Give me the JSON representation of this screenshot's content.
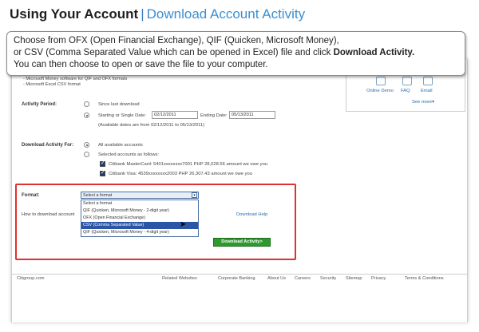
{
  "header": {
    "title_bold": "Using Your Account",
    "separator": "|",
    "title_sub": "Download Account Activity"
  },
  "callout": {
    "line1": "Choose from OFX (Open Financial Exchange), QIF (Quicken, Microsoft Money),",
    "line2_a": "or CSV (Comma Separated Value which can be opened in Excel) file and click ",
    "line2_b": "Download Activity.",
    "line3": "You can then choose to open or save the file to your computer."
  },
  "page": {
    "note1": "- Microsoft Money software for QIF and OFX formats",
    "note2": "- Microsoft Excel CSV format",
    "sidebar": {
      "online_demo": "Online Demo",
      "faq": "FAQ",
      "email": "Email",
      "see_more": "See more▾"
    },
    "activity_period": {
      "label": "Activity Period:",
      "opt1": "Since last download",
      "opt2": "Starting or Single Date:",
      "start_date": "02/12/2011",
      "ending_label": "Ending Date:",
      "end_date": "05/13/2011",
      "available": "(Available dates are from 02/12/2011 to 05/13/2011)"
    },
    "download_for": {
      "label": "Download Activity For:",
      "opt1": "All available accounts",
      "opt2": "Selected accounts as follows:",
      "acct1": "Citibank MasterCard: 5401xxxxxxxx7001 PHP 28,028.56 amount we owe you",
      "acct2": "Citibank Visa: 4539xxxxxxxx2003 PHP 26,307.43 amount we owe you"
    },
    "format": {
      "label": "Format:",
      "selected": "Select a format",
      "options": [
        "Select a format",
        "QIF (Quicken, Microsoft Money - 2-digit year)",
        "OFX (Open Financial Exchange)",
        "CSV (Comma Separated Value)",
        "QIF (Quicken, Microsoft Money - 4-digit year)"
      ],
      "how_to": "How to download account",
      "download_help": "Download Help"
    },
    "download_button": "Download Activity>"
  },
  "footer": {
    "site": "Citigroup.com",
    "links": [
      "Related Websites",
      "Corporate Banking",
      "About Us",
      "Careers",
      "Security",
      "Sitemap",
      "Privacy",
      "Terms & Conditions"
    ]
  },
  "colors": {
    "title_blue": "#3b8fd1",
    "highlight_red": "#e03030",
    "button_green": "#2e9a2e",
    "selected_option": "#2b56a6"
  }
}
